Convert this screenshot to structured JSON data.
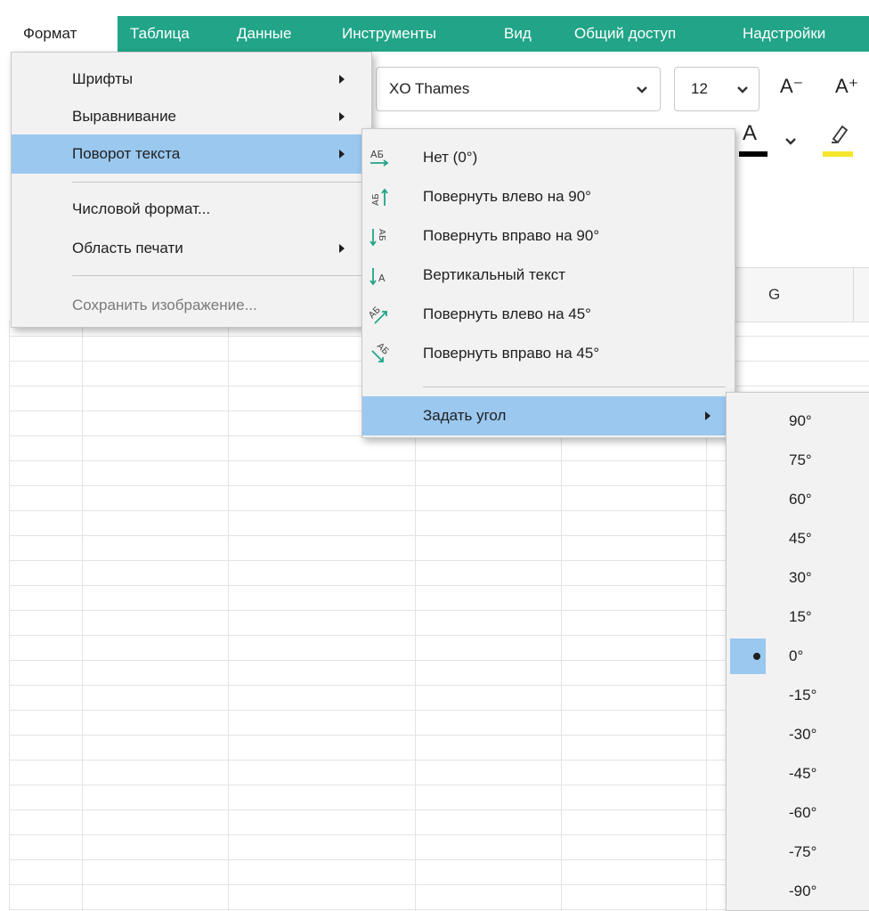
{
  "menubar": {
    "items": [
      "Формат",
      "Таблица",
      "Данные",
      "Инструменты",
      "Вид",
      "Общий доступ",
      "Надстройки"
    ]
  },
  "toolbar": {
    "font_name": "XO Thames",
    "font_size": "12",
    "increase_font": "A⁺",
    "decrease_font": "A⁻",
    "font_color_letter": "A"
  },
  "grid": {
    "column_g": "G"
  },
  "format_menu": {
    "items": [
      {
        "label": "Шрифты",
        "submenu": true
      },
      {
        "label": "Выравнивание",
        "submenu": true
      },
      {
        "label": "Поворот текста",
        "submenu": true
      },
      {
        "label": "Числовой формат...",
        "submenu": false
      },
      {
        "label": "Область печати",
        "submenu": true
      },
      {
        "label": "Сохранить изображение...",
        "submenu": false,
        "disabled": true
      }
    ]
  },
  "rotation_menu": {
    "items": [
      {
        "label": "Нет (0°)",
        "icon": "text-no-rotation-icon"
      },
      {
        "label": "Повернуть влево на 90°",
        "icon": "rotate-left-90-icon"
      },
      {
        "label": "Повернуть вправо на 90°",
        "icon": "rotate-right-90-icon"
      },
      {
        "label": "Вертикальный текст",
        "icon": "vertical-text-icon"
      },
      {
        "label": "Повернуть влево на 45°",
        "icon": "rotate-left-45-icon"
      },
      {
        "label": "Повернуть вправо на 45°",
        "icon": "rotate-right-45-icon"
      }
    ],
    "set_angle": "Задать угол"
  },
  "angle_menu": {
    "items": [
      "90°",
      "75°",
      "60°",
      "45°",
      "30°",
      "15°",
      "0°",
      "-15°",
      "-30°",
      "-45°",
      "-60°",
      "-75°",
      "-90°"
    ],
    "selected": "0°"
  },
  "colors": {
    "accent": "#21a487",
    "highlight": "#9ac8ef",
    "menu_bg": "#f2f2f2"
  }
}
